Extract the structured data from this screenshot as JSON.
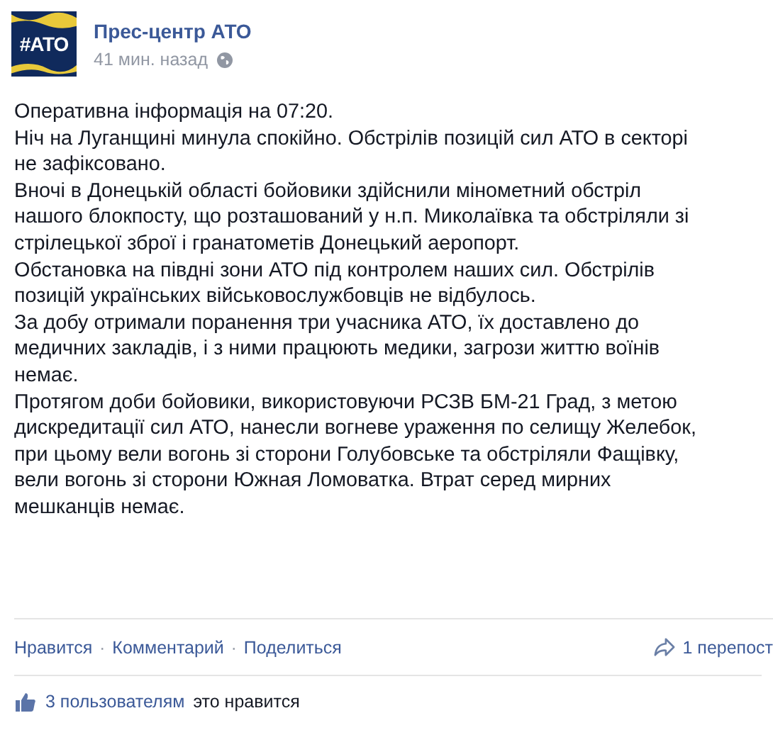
{
  "page": {
    "logo_text": "#АТО",
    "name": "Прес-центр АТО",
    "time": "41 мин. назад"
  },
  "paragraphs": [
    "Оперативна інформація на 07:20.",
    "Ніч на Луганщині минула спокійно. Обстрілів позицій сил АТО в секторі не зафіксовано.",
    "Вночі в Донецькій області бойовики здійснили мінометний обстріл нашого блокпосту, що розташований у н.п. Миколаївка та обстріляли зі стрілецької зброї і гранатометів Донецький аеропорт.",
    "Обстановка на півдні зони АТО під контролем наших сил. Обстрілів позицій українських військовослужбовців не відбулось.",
    "За добу отримали поранення три учасника АТО, їх доставлено до медичних закладів, і з ними працюють медики, загрози життю воїнів немає.",
    "Протягом доби бойовики, використовуючи РСЗВ БМ-21 Град, з метою дискредитації сил АТО, нанесли вогневе ураження по селищу Желебок, при цьому вели вогонь зі сторони Голубовське та обстріляли Фащівку, вели вогонь зі сторони Южная Ломоватка. Втрат серед мирних мешканців немає."
  ],
  "actions": [
    "Нравится",
    "Комментарий",
    "Поделиться"
  ],
  "separator": "·",
  "shares": "1 перепост",
  "likes": {
    "count": "3 пользователям",
    "rest": "это нравится"
  }
}
